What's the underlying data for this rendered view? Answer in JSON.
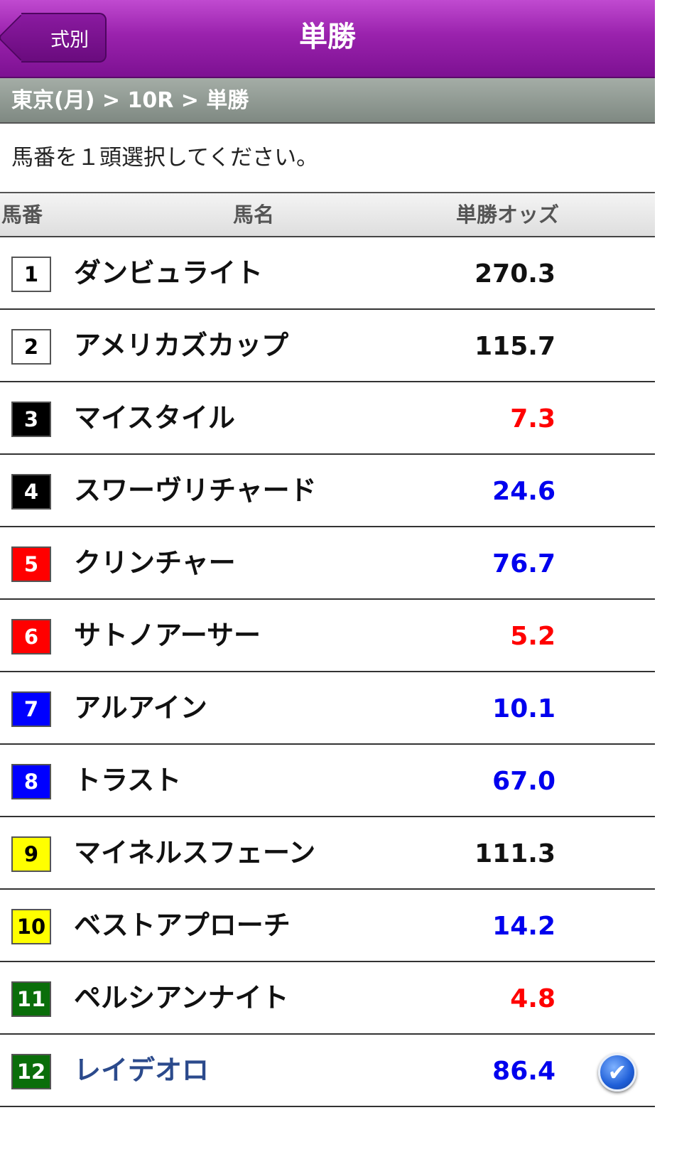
{
  "nav": {
    "back_label": "式別",
    "title": "単勝"
  },
  "breadcrumb": "東京(月) > 10R > 単勝",
  "instruction": "馬番を１頭選択してください。",
  "table": {
    "headers": {
      "num": "馬番",
      "name": "馬名",
      "odds": "単勝オッズ"
    },
    "rows": [
      {
        "num": "1",
        "name": "ダンビュライト",
        "odds": "270.3",
        "box_bg": "#ffffff",
        "box_fg": "#000000",
        "odds_color": "#111111"
      },
      {
        "num": "2",
        "name": "アメリカズカップ",
        "odds": "115.7",
        "box_bg": "#ffffff",
        "box_fg": "#000000",
        "odds_color": "#111111"
      },
      {
        "num": "3",
        "name": "マイスタイル",
        "odds": "7.3",
        "box_bg": "#000000",
        "box_fg": "#ffffff",
        "odds_color": "#ff0000"
      },
      {
        "num": "4",
        "name": "スワーヴリチャード",
        "odds": "24.6",
        "box_bg": "#000000",
        "box_fg": "#ffffff",
        "odds_color": "#0000ee"
      },
      {
        "num": "5",
        "name": "クリンチャー",
        "odds": "76.7",
        "box_bg": "#ff0000",
        "box_fg": "#ffffff",
        "odds_color": "#0000ee"
      },
      {
        "num": "6",
        "name": "サトノアーサー",
        "odds": "5.2",
        "box_bg": "#ff0000",
        "box_fg": "#ffffff",
        "odds_color": "#ff0000"
      },
      {
        "num": "7",
        "name": "アルアイン",
        "odds": "10.1",
        "box_bg": "#0000ff",
        "box_fg": "#ffffff",
        "odds_color": "#0000ee"
      },
      {
        "num": "8",
        "name": "トラスト",
        "odds": "67.0",
        "box_bg": "#0000ff",
        "box_fg": "#ffffff",
        "odds_color": "#0000ee"
      },
      {
        "num": "9",
        "name": "マイネルスフェーン",
        "odds": "111.3",
        "box_bg": "#ffff00",
        "box_fg": "#000000",
        "odds_color": "#111111"
      },
      {
        "num": "10",
        "name": "ベストアプローチ",
        "odds": "14.2",
        "box_bg": "#ffff00",
        "box_fg": "#000000",
        "odds_color": "#0000ee"
      },
      {
        "num": "11",
        "name": "ペルシアンナイト",
        "odds": "4.8",
        "box_bg": "#0a6e0a",
        "box_fg": "#ffffff",
        "odds_color": "#ff0000"
      },
      {
        "num": "12",
        "name": "レイデオロ",
        "odds": "86.4",
        "box_bg": "#0a6e0a",
        "box_fg": "#ffffff",
        "odds_color": "#0000ee",
        "selected": true
      }
    ]
  },
  "icons": {
    "back": "back-arrow-icon",
    "selected": "checkmark-icon"
  }
}
